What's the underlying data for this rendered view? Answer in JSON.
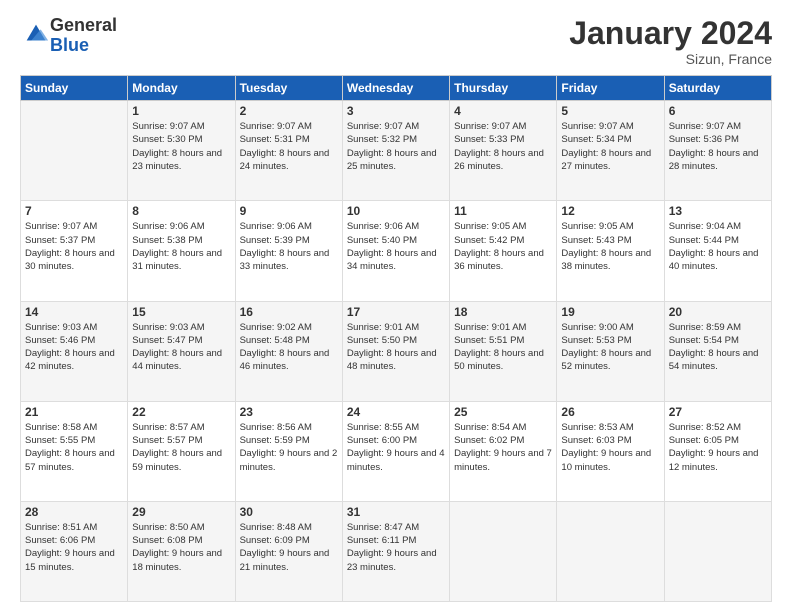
{
  "logo": {
    "general": "General",
    "blue": "Blue"
  },
  "header": {
    "month_title": "January 2024",
    "location": "Sizun, France"
  },
  "weekdays": [
    "Sunday",
    "Monday",
    "Tuesday",
    "Wednesday",
    "Thursday",
    "Friday",
    "Saturday"
  ],
  "weeks": [
    [
      {
        "day": "",
        "sunrise": "",
        "sunset": "",
        "daylight": ""
      },
      {
        "day": "1",
        "sunrise": "Sunrise: 9:07 AM",
        "sunset": "Sunset: 5:30 PM",
        "daylight": "Daylight: 8 hours and 23 minutes."
      },
      {
        "day": "2",
        "sunrise": "Sunrise: 9:07 AM",
        "sunset": "Sunset: 5:31 PM",
        "daylight": "Daylight: 8 hours and 24 minutes."
      },
      {
        "day": "3",
        "sunrise": "Sunrise: 9:07 AM",
        "sunset": "Sunset: 5:32 PM",
        "daylight": "Daylight: 8 hours and 25 minutes."
      },
      {
        "day": "4",
        "sunrise": "Sunrise: 9:07 AM",
        "sunset": "Sunset: 5:33 PM",
        "daylight": "Daylight: 8 hours and 26 minutes."
      },
      {
        "day": "5",
        "sunrise": "Sunrise: 9:07 AM",
        "sunset": "Sunset: 5:34 PM",
        "daylight": "Daylight: 8 hours and 27 minutes."
      },
      {
        "day": "6",
        "sunrise": "Sunrise: 9:07 AM",
        "sunset": "Sunset: 5:36 PM",
        "daylight": "Daylight: 8 hours and 28 minutes."
      }
    ],
    [
      {
        "day": "7",
        "sunrise": "Sunrise: 9:07 AM",
        "sunset": "Sunset: 5:37 PM",
        "daylight": "Daylight: 8 hours and 30 minutes."
      },
      {
        "day": "8",
        "sunrise": "Sunrise: 9:06 AM",
        "sunset": "Sunset: 5:38 PM",
        "daylight": "Daylight: 8 hours and 31 minutes."
      },
      {
        "day": "9",
        "sunrise": "Sunrise: 9:06 AM",
        "sunset": "Sunset: 5:39 PM",
        "daylight": "Daylight: 8 hours and 33 minutes."
      },
      {
        "day": "10",
        "sunrise": "Sunrise: 9:06 AM",
        "sunset": "Sunset: 5:40 PM",
        "daylight": "Daylight: 8 hours and 34 minutes."
      },
      {
        "day": "11",
        "sunrise": "Sunrise: 9:05 AM",
        "sunset": "Sunset: 5:42 PM",
        "daylight": "Daylight: 8 hours and 36 minutes."
      },
      {
        "day": "12",
        "sunrise": "Sunrise: 9:05 AM",
        "sunset": "Sunset: 5:43 PM",
        "daylight": "Daylight: 8 hours and 38 minutes."
      },
      {
        "day": "13",
        "sunrise": "Sunrise: 9:04 AM",
        "sunset": "Sunset: 5:44 PM",
        "daylight": "Daylight: 8 hours and 40 minutes."
      }
    ],
    [
      {
        "day": "14",
        "sunrise": "Sunrise: 9:03 AM",
        "sunset": "Sunset: 5:46 PM",
        "daylight": "Daylight: 8 hours and 42 minutes."
      },
      {
        "day": "15",
        "sunrise": "Sunrise: 9:03 AM",
        "sunset": "Sunset: 5:47 PM",
        "daylight": "Daylight: 8 hours and 44 minutes."
      },
      {
        "day": "16",
        "sunrise": "Sunrise: 9:02 AM",
        "sunset": "Sunset: 5:48 PM",
        "daylight": "Daylight: 8 hours and 46 minutes."
      },
      {
        "day": "17",
        "sunrise": "Sunrise: 9:01 AM",
        "sunset": "Sunset: 5:50 PM",
        "daylight": "Daylight: 8 hours and 48 minutes."
      },
      {
        "day": "18",
        "sunrise": "Sunrise: 9:01 AM",
        "sunset": "Sunset: 5:51 PM",
        "daylight": "Daylight: 8 hours and 50 minutes."
      },
      {
        "day": "19",
        "sunrise": "Sunrise: 9:00 AM",
        "sunset": "Sunset: 5:53 PM",
        "daylight": "Daylight: 8 hours and 52 minutes."
      },
      {
        "day": "20",
        "sunrise": "Sunrise: 8:59 AM",
        "sunset": "Sunset: 5:54 PM",
        "daylight": "Daylight: 8 hours and 54 minutes."
      }
    ],
    [
      {
        "day": "21",
        "sunrise": "Sunrise: 8:58 AM",
        "sunset": "Sunset: 5:55 PM",
        "daylight": "Daylight: 8 hours and 57 minutes."
      },
      {
        "day": "22",
        "sunrise": "Sunrise: 8:57 AM",
        "sunset": "Sunset: 5:57 PM",
        "daylight": "Daylight: 8 hours and 59 minutes."
      },
      {
        "day": "23",
        "sunrise": "Sunrise: 8:56 AM",
        "sunset": "Sunset: 5:59 PM",
        "daylight": "Daylight: 9 hours and 2 minutes."
      },
      {
        "day": "24",
        "sunrise": "Sunrise: 8:55 AM",
        "sunset": "Sunset: 6:00 PM",
        "daylight": "Daylight: 9 hours and 4 minutes."
      },
      {
        "day": "25",
        "sunrise": "Sunrise: 8:54 AM",
        "sunset": "Sunset: 6:02 PM",
        "daylight": "Daylight: 9 hours and 7 minutes."
      },
      {
        "day": "26",
        "sunrise": "Sunrise: 8:53 AM",
        "sunset": "Sunset: 6:03 PM",
        "daylight": "Daylight: 9 hours and 10 minutes."
      },
      {
        "day": "27",
        "sunrise": "Sunrise: 8:52 AM",
        "sunset": "Sunset: 6:05 PM",
        "daylight": "Daylight: 9 hours and 12 minutes."
      }
    ],
    [
      {
        "day": "28",
        "sunrise": "Sunrise: 8:51 AM",
        "sunset": "Sunset: 6:06 PM",
        "daylight": "Daylight: 9 hours and 15 minutes."
      },
      {
        "day": "29",
        "sunrise": "Sunrise: 8:50 AM",
        "sunset": "Sunset: 6:08 PM",
        "daylight": "Daylight: 9 hours and 18 minutes."
      },
      {
        "day": "30",
        "sunrise": "Sunrise: 8:48 AM",
        "sunset": "Sunset: 6:09 PM",
        "daylight": "Daylight: 9 hours and 21 minutes."
      },
      {
        "day": "31",
        "sunrise": "Sunrise: 8:47 AM",
        "sunset": "Sunset: 6:11 PM",
        "daylight": "Daylight: 9 hours and 23 minutes."
      },
      {
        "day": "",
        "sunrise": "",
        "sunset": "",
        "daylight": ""
      },
      {
        "day": "",
        "sunrise": "",
        "sunset": "",
        "daylight": ""
      },
      {
        "day": "",
        "sunrise": "",
        "sunset": "",
        "daylight": ""
      }
    ]
  ]
}
